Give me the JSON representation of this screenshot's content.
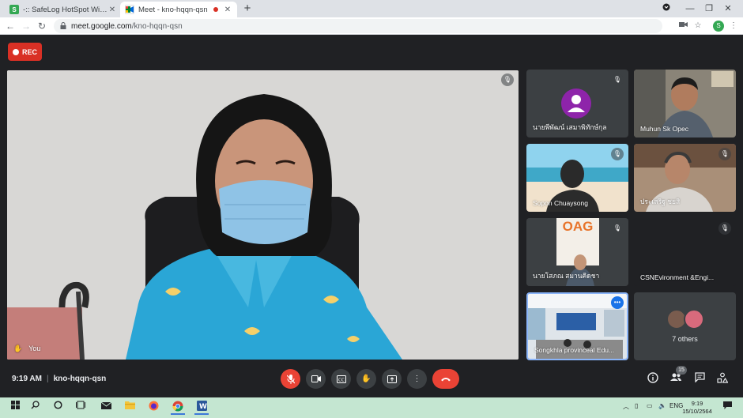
{
  "browser": {
    "tabs": [
      {
        "title": "-:: SafeLog HotSpot Wifi Internet",
        "favicon": "S"
      },
      {
        "title": "Meet - kno-hqqn-qsn",
        "favicon": "meet-icon"
      }
    ],
    "new_tab": "+",
    "url_host": "meet.google.com",
    "url_path": "/kno-hqqn-qsn",
    "profile_initial": "S"
  },
  "meet": {
    "rec_label": "REC",
    "main_tile": {
      "label": "You"
    },
    "participants": [
      {
        "name": "นายพีพัฒน์ เสมาพิทักษ์กุล",
        "muted": true,
        "video": false
      },
      {
        "name": "Muhun Sk Opec",
        "muted": false,
        "video": true
      },
      {
        "name": "Sopon Chuaysong",
        "muted": true,
        "video": true
      },
      {
        "name": "ประเสริฐ ชยสิ",
        "muted": true,
        "video": true
      },
      {
        "name": "นายโสภณ สมานคิดชา",
        "muted": true,
        "video": true,
        "poster_text": "OAG"
      },
      {
        "name": "CSNEvironment &Engi...",
        "muted": true,
        "video": false
      },
      {
        "name": "Songkhla provinceal Edu...",
        "muted": false,
        "video": true,
        "speaking": true,
        "menu": "•••"
      }
    ],
    "others_label": "7 others",
    "time": "9:19 AM",
    "meeting_code": "kno-hqqn-qsn",
    "people_count": "15"
  },
  "taskbar": {
    "language": "ENG",
    "time": "9:19",
    "date": "15/10/2564"
  },
  "colors": {
    "meet_background": "#202124",
    "tile_background": "#3c4043",
    "red_button": "#ea4335",
    "rec_red": "#d93025",
    "speaking_border": "#8ab4f8",
    "taskbar": "#c4e6d1"
  }
}
